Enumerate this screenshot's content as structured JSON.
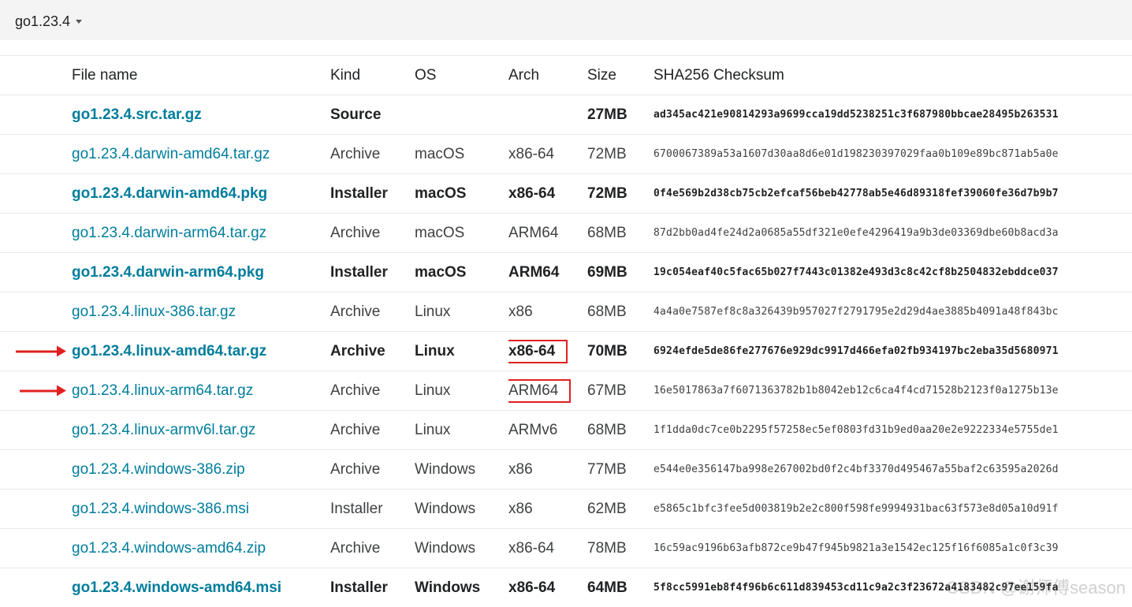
{
  "version": {
    "label": "go1.23.4"
  },
  "table": {
    "headers": {
      "file": "File name",
      "kind": "Kind",
      "os": "OS",
      "arch": "Arch",
      "size": "Size",
      "sha": "SHA256 Checksum"
    },
    "rows": [
      {
        "file": "go1.23.4.src.tar.gz",
        "kind": "Source",
        "os": "",
        "arch": "",
        "size": "27MB",
        "sha": "ad345ac421e90814293a9699cca19dd5238251c3f687980bbcae28495b263531",
        "featured": true
      },
      {
        "file": "go1.23.4.darwin-amd64.tar.gz",
        "kind": "Archive",
        "os": "macOS",
        "arch": "x86-64",
        "size": "72MB",
        "sha": "6700067389a53a1607d30aa8d6e01d198230397029faa0b109e89bc871ab5a0e",
        "featured": false
      },
      {
        "file": "go1.23.4.darwin-amd64.pkg",
        "kind": "Installer",
        "os": "macOS",
        "arch": "x86-64",
        "size": "72MB",
        "sha": "0f4e569b2d38cb75cb2efcaf56beb42778ab5e46d89318fef39060fe36d7b9b7",
        "featured": true
      },
      {
        "file": "go1.23.4.darwin-arm64.tar.gz",
        "kind": "Archive",
        "os": "macOS",
        "arch": "ARM64",
        "size": "68MB",
        "sha": "87d2bb0ad4fe24d2a0685a55df321e0efe4296419a9b3de03369dbe60b8acd3a",
        "featured": false
      },
      {
        "file": "go1.23.4.darwin-arm64.pkg",
        "kind": "Installer",
        "os": "macOS",
        "arch": "ARM64",
        "size": "69MB",
        "sha": "19c054eaf40c5fac65b027f7443c01382e493d3c8c42cf8b2504832ebddce037",
        "featured": true
      },
      {
        "file": "go1.23.4.linux-386.tar.gz",
        "kind": "Archive",
        "os": "Linux",
        "arch": "x86",
        "size": "68MB",
        "sha": "4a4a0e7587ef8c8a326439b957027f2791795e2d29d4ae3885b4091a48f843bc",
        "featured": false
      },
      {
        "file": "go1.23.4.linux-amd64.tar.gz",
        "kind": "Archive",
        "os": "Linux",
        "arch": "x86-64",
        "size": "70MB",
        "sha": "6924efde5de86fe277676e929dc9917d466efa02fb934197bc2eba35d5680971",
        "featured": true
      },
      {
        "file": "go1.23.4.linux-arm64.tar.gz",
        "kind": "Archive",
        "os": "Linux",
        "arch": "ARM64",
        "size": "67MB",
        "sha": "16e5017863a7f6071363782b1b8042eb12c6ca4f4cd71528b2123f0a1275b13e",
        "featured": false
      },
      {
        "file": "go1.23.4.linux-armv6l.tar.gz",
        "kind": "Archive",
        "os": "Linux",
        "arch": "ARMv6",
        "size": "68MB",
        "sha": "1f1dda0dc7ce0b2295f57258ec5ef0803fd31b9ed0aa20e2e9222334e5755de1",
        "featured": false
      },
      {
        "file": "go1.23.4.windows-386.zip",
        "kind": "Archive",
        "os": "Windows",
        "arch": "x86",
        "size": "77MB",
        "sha": "e544e0e356147ba998e267002bd0f2c4bf3370d495467a55baf2c63595a2026d",
        "featured": false
      },
      {
        "file": "go1.23.4.windows-386.msi",
        "kind": "Installer",
        "os": "Windows",
        "arch": "x86",
        "size": "62MB",
        "sha": "e5865c1bfc3fee5d003819b2e2c800f598fe9994931bac63f573e8d05a10d91f",
        "featured": false
      },
      {
        "file": "go1.23.4.windows-amd64.zip",
        "kind": "Archive",
        "os": "Windows",
        "arch": "x86-64",
        "size": "78MB",
        "sha": "16c59ac9196b63afb872ce9b47f945b9821a3e1542ec125f16f6085a1c0f3c39",
        "featured": false
      },
      {
        "file": "go1.23.4.windows-amd64.msi",
        "kind": "Installer",
        "os": "Windows",
        "arch": "x86-64",
        "size": "64MB",
        "sha": "5f8cc5991eb8f4f96b6c611d839453cd11c9a2c3f23672a4183482c97ee159fa",
        "featured": true
      }
    ]
  },
  "annotations": {
    "color": "#e02020"
  },
  "watermark": {
    "text": "CSDN @谢师傅season"
  }
}
